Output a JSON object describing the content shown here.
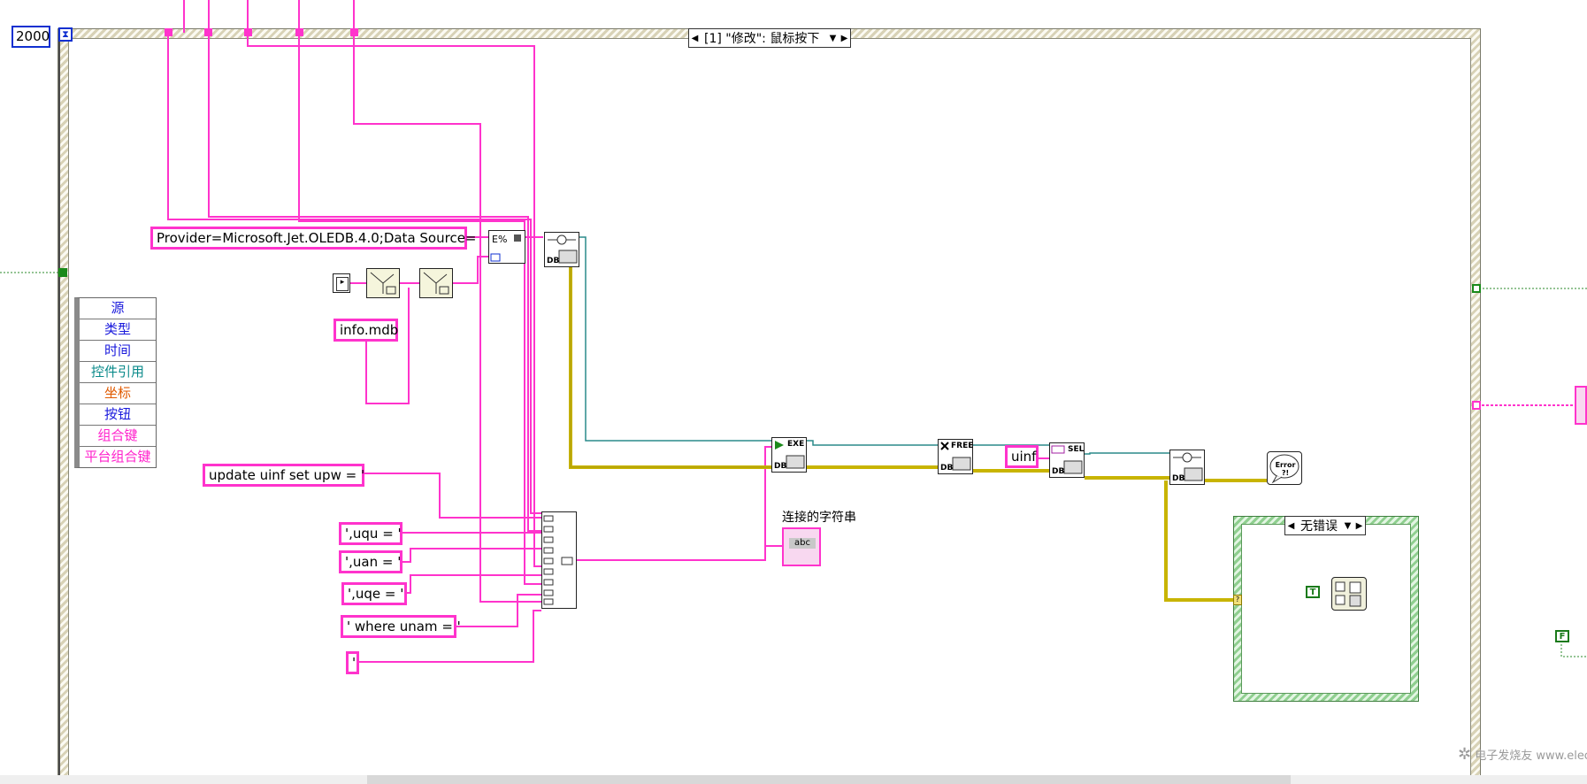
{
  "loop_count": "2000",
  "event_selector": {
    "label": "[1] \"修改\": 鼠标按下"
  },
  "case_selector": {
    "label": "无错误"
  },
  "constants": {
    "provider": "Provider=Microsoft.Jet.OLEDB.4.0;Data Source=",
    "db_file": "info.mdb",
    "sql_update": "update uinf set upw = '",
    "uqu": "',uqu = '",
    "uan": "',uan = '",
    "uqe": "',uqe = '",
    "where": "' where unam = '",
    "quote": "'",
    "table_name": "uinf"
  },
  "event_data": {
    "items": [
      "源",
      "类型",
      "时间",
      "控件引用",
      "坐标",
      "按钮",
      "组合键",
      "平台组合键"
    ],
    "colors": [
      "#1a1adc",
      "#1a1adc",
      "#1a1adc",
      "#0a8a8a",
      "#e05a00",
      "#1a1adc",
      "#ff22cc",
      "#ff22cc"
    ]
  },
  "indicator_label": "连接的字符串",
  "node_tags": {
    "db": "DB",
    "exe": "EXE",
    "free": "FREE",
    "sel": "SEL",
    "error": "Error ?!",
    "abc": "abc",
    "true_const": "T",
    "false_const": "F"
  },
  "watermark": "电子发烧友 www.elecfans.com",
  "colors": {
    "string_wire": "#ff33cc",
    "refnum_wire": "#2a8a8a",
    "error_wire": "#c8b400",
    "frame_hatch": "#d8d2b6",
    "case_green": "#4a9a4a"
  }
}
